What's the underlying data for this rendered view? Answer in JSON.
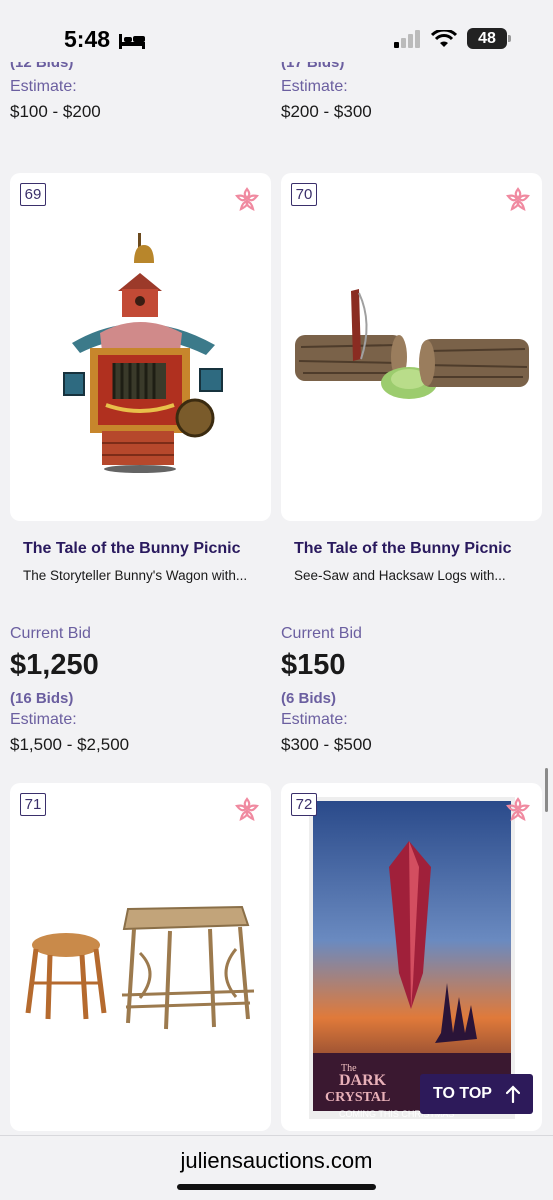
{
  "status_bar": {
    "time": "5:48",
    "battery": "48"
  },
  "previous_row": [
    {
      "bids_partial": "(12 Bids)",
      "estimate_label": "Estimate:",
      "estimate": "$100 - $200"
    },
    {
      "bids_partial": "(17 Bids)",
      "estimate_label": "Estimate:",
      "estimate": "$200 - $300"
    }
  ],
  "lots": [
    {
      "lot": "69",
      "title": "The Tale of the Bunny Picnic",
      "subtitle": "The Storyteller Bunny's Wagon with...",
      "current_bid_label": "Current Bid",
      "current_bid": "$1,250",
      "bids": "(16 Bids)",
      "estimate_label": "Estimate:",
      "estimate": "$1,500 - $2,500"
    },
    {
      "lot": "70",
      "title": "The Tale of the Bunny Picnic",
      "subtitle": "See-Saw and Hacksaw Logs with...",
      "current_bid_label": "Current Bid",
      "current_bid": "$150",
      "bids": "(6 Bids)",
      "estimate_label": "Estimate:",
      "estimate": "$300 - $500"
    },
    {
      "lot": "71"
    },
    {
      "lot": "72",
      "poster_text": {
        "logo_line1": "The",
        "logo_line2": "DARK",
        "logo_line3": "CRYSTAL",
        "tagline": "COMING THIS CHRISTMAS"
      }
    }
  ],
  "to_top_label": "TO TOP",
  "browser": {
    "domain": "juliensauctions.com"
  },
  "colors": {
    "accent": "#2d1a5a",
    "muted_purple": "#6b5fa0",
    "favorite_pink": "#f08aa0"
  }
}
